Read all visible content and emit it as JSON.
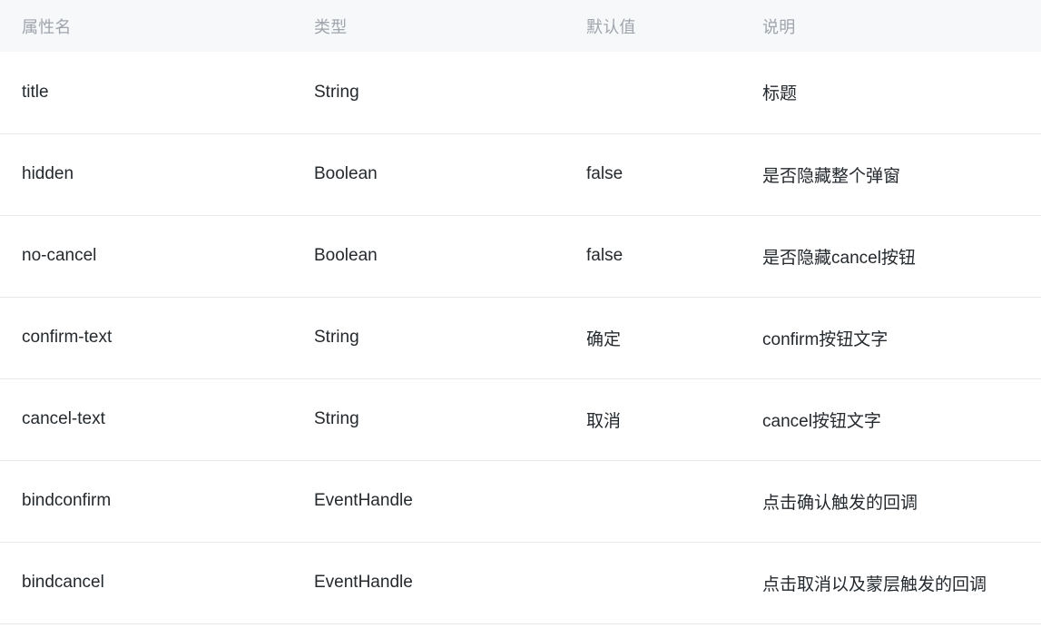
{
  "table": {
    "headers": [
      {
        "key": "name",
        "label": "属性名"
      },
      {
        "key": "type",
        "label": "类型"
      },
      {
        "key": "default",
        "label": "默认值"
      },
      {
        "key": "description",
        "label": "说明"
      }
    ],
    "rows": [
      {
        "name": "title",
        "type": "String",
        "default": "",
        "description": "标题"
      },
      {
        "name": "hidden",
        "type": "Boolean",
        "default": "false",
        "description": "是否隐藏整个弹窗"
      },
      {
        "name": "no-cancel",
        "type": "Boolean",
        "default": "false",
        "description": "是否隐藏cancel按钮"
      },
      {
        "name": "confirm-text",
        "type": "String",
        "default": "确定",
        "description": "confirm按钮文字"
      },
      {
        "name": "cancel-text",
        "type": "String",
        "default": "取消",
        "description": "cancel按钮文字"
      },
      {
        "name": "bindconfirm",
        "type": "EventHandle",
        "default": "",
        "description": "点击确认触发的回调"
      },
      {
        "name": "bindcancel",
        "type": "EventHandle",
        "default": "",
        "description": "点击取消以及蒙层触发的回调"
      }
    ]
  },
  "colors": {
    "header_background": "#f6f8fa",
    "header_text": "#a0a4ab",
    "body_text": "#24292e",
    "row_divider": "#e8e8e8",
    "page_background": "#ffffff"
  }
}
